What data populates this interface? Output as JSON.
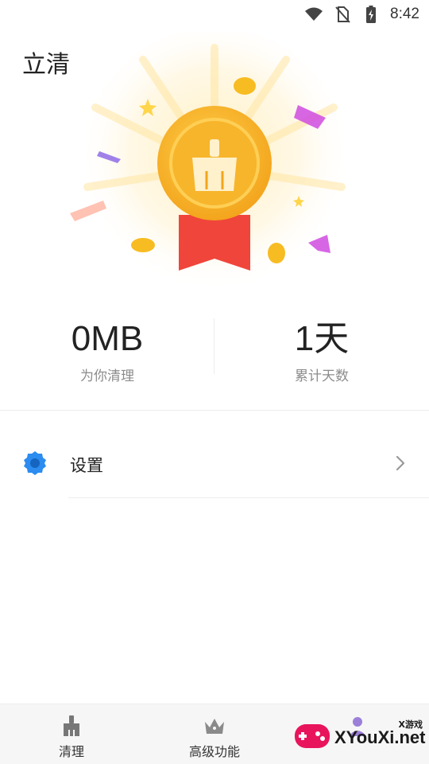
{
  "status_bar": {
    "time": "8:42",
    "icons": [
      "wifi-icon",
      "no-sim-icon",
      "battery-charging-icon"
    ]
  },
  "app": {
    "title": "立清"
  },
  "hero": {
    "icon": "broom-medal-icon"
  },
  "stats": {
    "cleaned_value": "0MB",
    "cleaned_label": "为你清理",
    "days_value": "1天",
    "days_label": "累计天数"
  },
  "settings": {
    "label": "设置",
    "icon": "gear-icon"
  },
  "bottom_nav": {
    "items": [
      {
        "label": "清理",
        "icon": "broom-icon"
      },
      {
        "label": "高级功能",
        "icon": "crown-icon"
      },
      {
        "label": "",
        "icon": "profile-icon"
      }
    ]
  },
  "watermark": {
    "text": "XYouXi.net",
    "small": "X游戏"
  },
  "colors": {
    "medal_gold": "#f7b52c",
    "ribbon_red": "#f0453a",
    "settings_blue": "#2c8cf0"
  }
}
